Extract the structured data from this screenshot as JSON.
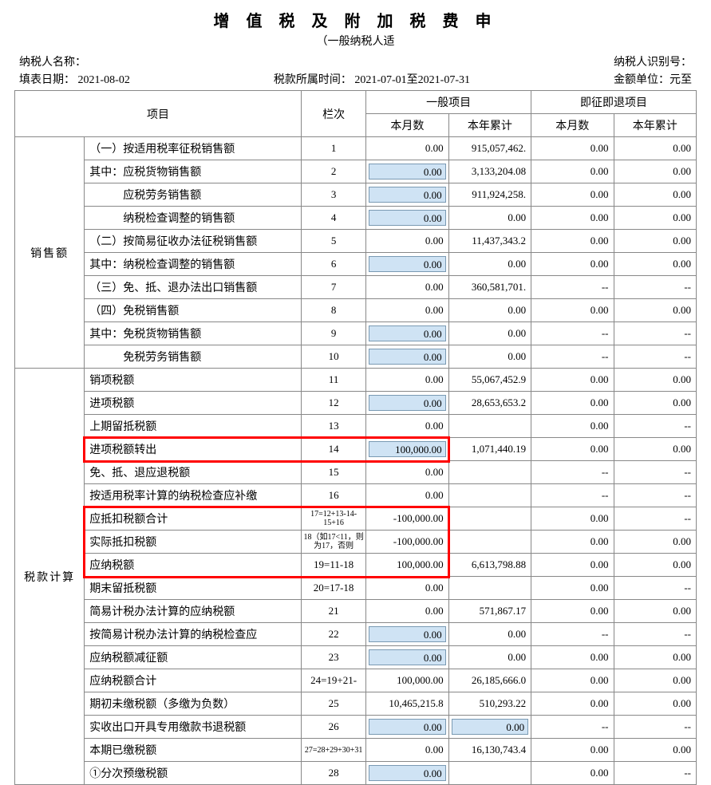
{
  "header": {
    "title": "增 值 税 及 附 加 税 费 申",
    "subtitle": "（一般纳税人适",
    "taxpayer_name_label": "纳税人名称：",
    "taxpayer_id_label": "纳税人识别号：",
    "fill_date_label": "填表日期：",
    "fill_date": "2021-08-02",
    "period_label": "税款所属时间：",
    "period": "2021-07-01至2021-07-31",
    "unit_label": "金额单位：元至"
  },
  "columns": {
    "item": "项目",
    "seq": "栏次",
    "general": "一般项目",
    "refund": "即征即退项目",
    "month": "本月数",
    "year": "本年累计"
  },
  "groups": {
    "sales": "销售额",
    "calc": "税款计算"
  },
  "rows": [
    {
      "grp": "sales",
      "item": "（一）按适用税率征税销售额",
      "seq": "1",
      "m1": "0.00",
      "y1": "915,057,462.",
      "m2": "0.00",
      "y2": "0.00",
      "m1_input": false
    },
    {
      "grp": "sales",
      "item": "其中：应税货物销售额",
      "seq": "2",
      "m1": "0.00",
      "y1": "3,133,204.08",
      "m2": "0.00",
      "y2": "0.00",
      "m1_input": true
    },
    {
      "grp": "sales",
      "item": "　　　应税劳务销售额",
      "seq": "3",
      "m1": "0.00",
      "y1": "911,924,258.",
      "m2": "0.00",
      "y2": "0.00",
      "m1_input": true
    },
    {
      "grp": "sales",
      "item": "　　　纳税检查调整的销售额",
      "seq": "4",
      "m1": "0.00",
      "y1": "0.00",
      "m2": "0.00",
      "y2": "0.00",
      "m1_input": true
    },
    {
      "grp": "sales",
      "item": "（二）按简易征收办法征税销售额",
      "seq": "5",
      "m1": "0.00",
      "y1": "11,437,343.2",
      "m2": "0.00",
      "y2": "0.00",
      "m1_input": false
    },
    {
      "grp": "sales",
      "item": "其中：纳税检查调整的销售额",
      "seq": "6",
      "m1": "0.00",
      "y1": "0.00",
      "m2": "0.00",
      "y2": "0.00",
      "m1_input": true
    },
    {
      "grp": "sales",
      "item": "（三）免、抵、退办法出口销售额",
      "seq": "7",
      "m1": "0.00",
      "y1": "360,581,701.",
      "m2": "--",
      "y2": "--",
      "m1_input": false
    },
    {
      "grp": "sales",
      "item": "（四）免税销售额",
      "seq": "8",
      "m1": "0.00",
      "y1": "0.00",
      "m2": "0.00",
      "y2": "0.00",
      "m1_input": false
    },
    {
      "grp": "sales",
      "item": "其中：免税货物销售额",
      "seq": "9",
      "m1": "0.00",
      "y1": "0.00",
      "m2": "--",
      "y2": "--",
      "m1_input": true
    },
    {
      "grp": "sales",
      "item": "　　　免税劳务销售额",
      "seq": "10",
      "m1": "0.00",
      "y1": "0.00",
      "m2": "--",
      "y2": "--",
      "m1_input": true
    },
    {
      "grp": "calc",
      "item": "销项税额",
      "seq": "11",
      "m1": "0.00",
      "y1": "55,067,452.9",
      "m2": "0.00",
      "y2": "0.00",
      "m1_input": false
    },
    {
      "grp": "calc",
      "item": "进项税额",
      "seq": "12",
      "m1": "0.00",
      "y1": "28,653,653.2",
      "m2": "0.00",
      "y2": "0.00",
      "m1_input": true
    },
    {
      "grp": "calc",
      "item": "上期留抵税额",
      "seq": "13",
      "m1": "0.00",
      "y1": "",
      "m2": "0.00",
      "y2": "--",
      "m1_input": false
    },
    {
      "grp": "calc",
      "item": "进项税额转出",
      "seq": "14",
      "m1": "100,000.00",
      "y1": "1,071,440.19",
      "m2": "0.00",
      "y2": "0.00",
      "m1_input": true,
      "hl": "single"
    },
    {
      "grp": "calc",
      "item": "免、抵、退应退税额",
      "seq": "15",
      "m1": "0.00",
      "y1": "",
      "m2": "--",
      "y2": "--",
      "m1_input": false
    },
    {
      "grp": "calc",
      "item": "按适用税率计算的纳税检查应补缴",
      "seq": "16",
      "m1": "0.00",
      "y1": "",
      "m2": "--",
      "y2": "--",
      "m1_input": false
    },
    {
      "grp": "calc",
      "item": "应抵扣税额合计",
      "seq": "17=12+13-14-15+16",
      "seq_small": true,
      "m1": "-100,000.00",
      "y1": "",
      "m2": "0.00",
      "y2": "--",
      "m1_input": false,
      "hl": "top"
    },
    {
      "grp": "calc",
      "item": "实际抵扣税额",
      "seq": "18（如17<11，则为17，否则",
      "seq_small": true,
      "m1": "-100,000.00",
      "y1": "",
      "m2": "0.00",
      "y2": "0.00",
      "m1_input": false,
      "hl": "mid"
    },
    {
      "grp": "calc",
      "item": "应纳税额",
      "seq": "19=11-18",
      "m1": "100,000.00",
      "y1": "6,613,798.88",
      "m2": "0.00",
      "y2": "0.00",
      "m1_input": false,
      "hl": "bot"
    },
    {
      "grp": "calc",
      "item": "期末留抵税额",
      "seq": "20=17-18",
      "m1": "0.00",
      "y1": "",
      "m2": "0.00",
      "y2": "--",
      "m1_input": false
    },
    {
      "grp": "calc",
      "item": "简易计税办法计算的应纳税额",
      "seq": "21",
      "m1": "0.00",
      "y1": "571,867.17",
      "m2": "0.00",
      "y2": "0.00",
      "m1_input": false
    },
    {
      "grp": "calc",
      "item": "按简易计税办法计算的纳税检查应",
      "seq": "22",
      "m1": "0.00",
      "y1": "0.00",
      "m2": "--",
      "y2": "--",
      "m1_input": true
    },
    {
      "grp": "calc",
      "item": "应纳税额减征额",
      "seq": "23",
      "m1": "0.00",
      "y1": "0.00",
      "m2": "0.00",
      "y2": "0.00",
      "m1_input": true
    },
    {
      "grp": "calc",
      "item": "应纳税额合计",
      "seq": "24=19+21-",
      "seq_small": false,
      "m1": "100,000.00",
      "y1": "26,185,666.0",
      "m2": "0.00",
      "y2": "0.00",
      "m1_input": false
    },
    {
      "grp": "calc",
      "item": "期初未缴税额（多缴为负数）",
      "seq": "25",
      "m1": "10,465,215.8",
      "y1": "510,293.22",
      "m2": "0.00",
      "y2": "0.00",
      "m1_input": false
    },
    {
      "grp": "calc",
      "item": "实收出口开具专用缴款书退税额",
      "seq": "26",
      "m1": "0.00",
      "y1": "0.00",
      "m2": "--",
      "y2": "--",
      "m1_input": true,
      "y1_input": true
    },
    {
      "grp": "calc",
      "item": "本期已缴税额",
      "seq": "27=28+29+30+31",
      "seq_small": true,
      "m1": "0.00",
      "y1": "16,130,743.4",
      "m2": "0.00",
      "y2": "0.00",
      "m1_input": false
    },
    {
      "grp": "calc",
      "item": "①分次预缴税额",
      "seq": "28",
      "m1": "0.00",
      "y1": "",
      "m2": "0.00",
      "y2": "--",
      "m1_input": true
    }
  ]
}
